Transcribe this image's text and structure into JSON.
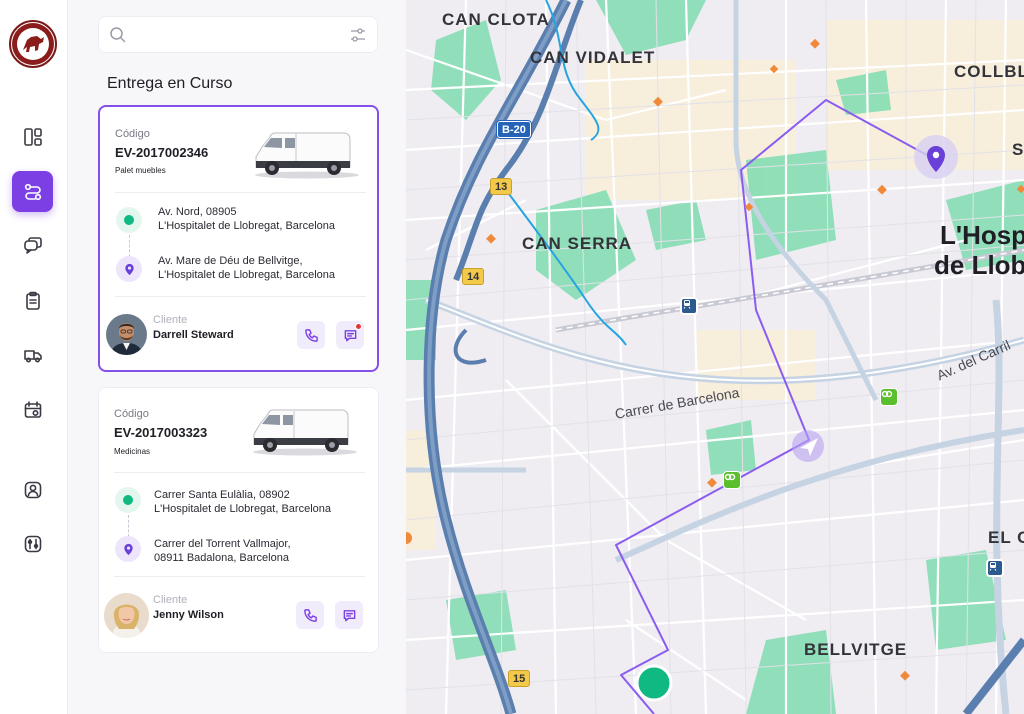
{
  "sidebar": {
    "logo_alt": "logo",
    "items": [
      {
        "name": "dashboard",
        "icon": "layout-grid-icon",
        "active": false
      },
      {
        "name": "routes",
        "icon": "route-icon",
        "active": true
      },
      {
        "name": "messages",
        "icon": "chat-icon",
        "active": false
      },
      {
        "name": "orders",
        "icon": "clipboard-icon",
        "active": false
      },
      {
        "name": "vehicles",
        "icon": "delivery-truck-icon",
        "active": false
      },
      {
        "name": "calendar",
        "icon": "calendar-icon",
        "active": false
      },
      {
        "name": "profile",
        "icon": "user-icon",
        "active": false
      },
      {
        "name": "settings",
        "icon": "settings-icon",
        "active": false
      }
    ]
  },
  "search": {
    "placeholder": "",
    "value": ""
  },
  "section_title": "Entrega en Curso",
  "deliveries": [
    {
      "code_label": "Código",
      "code": "EV-2017002346",
      "cargo": "Palet  muebles",
      "origin_line1": "Av. Nord, 08905",
      "origin_line2": "L'Hospitalet de Llobregat, Barcelona",
      "dest_line1": "Av. Mare de Déu de Bellvitge,",
      "dest_line2": "L'Hospitalet de Llobregat, Barcelona",
      "client_label": "Cliente",
      "client_name": "Darrell Steward",
      "has_unread": true,
      "active": true
    },
    {
      "code_label": "Código",
      "code": "EV-2017003323",
      "cargo": "Medicinas",
      "origin_line1": "Carrer Santa Eulàlia, 08902",
      "origin_line2": "L'Hospitalet de Llobregat, Barcelona",
      "dest_line1": "Carrer del Torrent Vallmajor,",
      "dest_line2": "08911 Badalona, Barcelona",
      "client_label": "Cliente",
      "client_name": "Jenny Wilson",
      "has_unread": false,
      "active": false
    }
  ],
  "map": {
    "labels": {
      "can_clota": "CAN CLOTA",
      "can_vidalet": "CAN VIDALET",
      "collbl": "COLLBL",
      "can_serra": "CAN SERRA",
      "hosp1": "L'Hosp",
      "hosp2": "de Llob",
      "el": "EL C",
      "bellvitge": "BELLVITGE",
      "s": "S",
      "carrer_barcelona": "Carrer de Barcelona",
      "av_carril": "Av. del Carril"
    },
    "shields": {
      "b20": "B-20",
      "r13": "13",
      "r14": "14",
      "r15": "15"
    },
    "colors": {
      "route": "#8a5cf0",
      "origin": "#10b981",
      "accent": "#7b3fe4"
    }
  }
}
